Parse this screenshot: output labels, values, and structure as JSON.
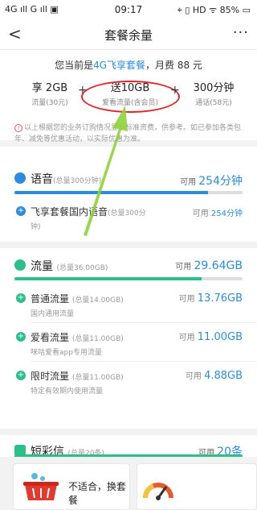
{
  "status_bar": {
    "left": "4G ıll G ıll ▣",
    "time": "09:17",
    "right": "⌖ ▯ HD ᯤ 85% ▭"
  },
  "nav": {
    "back": "<",
    "title": "套餐余量",
    "more": "···"
  },
  "plan": {
    "line_prefix": "您当前是",
    "plan_name": "4G飞享套餐",
    "line_suffix": "，月费 88 元",
    "features": [
      {
        "big": "享 2GB",
        "small": "流量(30元)"
      },
      {
        "big": "送10GB",
        "small": "爱看流量(含会员)"
      },
      {
        "big": "300分钟",
        "small": "通话(58元)"
      }
    ],
    "plus1": "+",
    "plus2": "+",
    "notice_icon": "!",
    "notice": "以上根据您的业务订购情况显示标准资费，供参考。如已参加各类包年、减免等优惠活动，以实际优惠为准。"
  },
  "colors": {
    "voice": "#2a8be0",
    "data": "#2bbf8a",
    "sms": "#2bbf8a",
    "accent": "#2a8be0",
    "circle": "#e0262a",
    "arrow": "#8ed13a"
  },
  "voice": {
    "title": "语音",
    "total": "(总量300分钟)",
    "avail_label": "可用",
    "avail": "254分钟",
    "fill_pct": 85,
    "items": [
      {
        "name": "飞享套餐国内语音",
        "total": "(总量300分",
        "desc": "钟)",
        "avail_label": "可用",
        "avail": "254分钟"
      }
    ]
  },
  "data": {
    "title": "流量",
    "total": "(总量36.00GB)",
    "avail_label": "可用",
    "avail": "29.64GB",
    "fill_pct": 82,
    "items": [
      {
        "name": "普通流量",
        "total": "(总量14.00GB)",
        "desc": "国内通用流量",
        "avail_label": "可用",
        "avail": "13.76GB"
      },
      {
        "name": "爱看流量",
        "total": "(总量11.00GB)",
        "desc": "咪咕爱看app专用流量",
        "avail_label": "可用",
        "avail": "11.00GB"
      },
      {
        "name": "限时流量",
        "total": "(总量11.00GB)",
        "desc": "特定有效期内使用流量",
        "avail_label": "可用",
        "avail": "4.88GB"
      }
    ]
  },
  "sms": {
    "title": "短彩信",
    "total": "(总量20条)",
    "avail_label": "可用",
    "avail": "20条",
    "fill_pct": 100
  },
  "ads": {
    "left_text": "不适合，换套餐",
    "left_icon": "basket-icon",
    "right_icon": "speedometer-icon"
  }
}
